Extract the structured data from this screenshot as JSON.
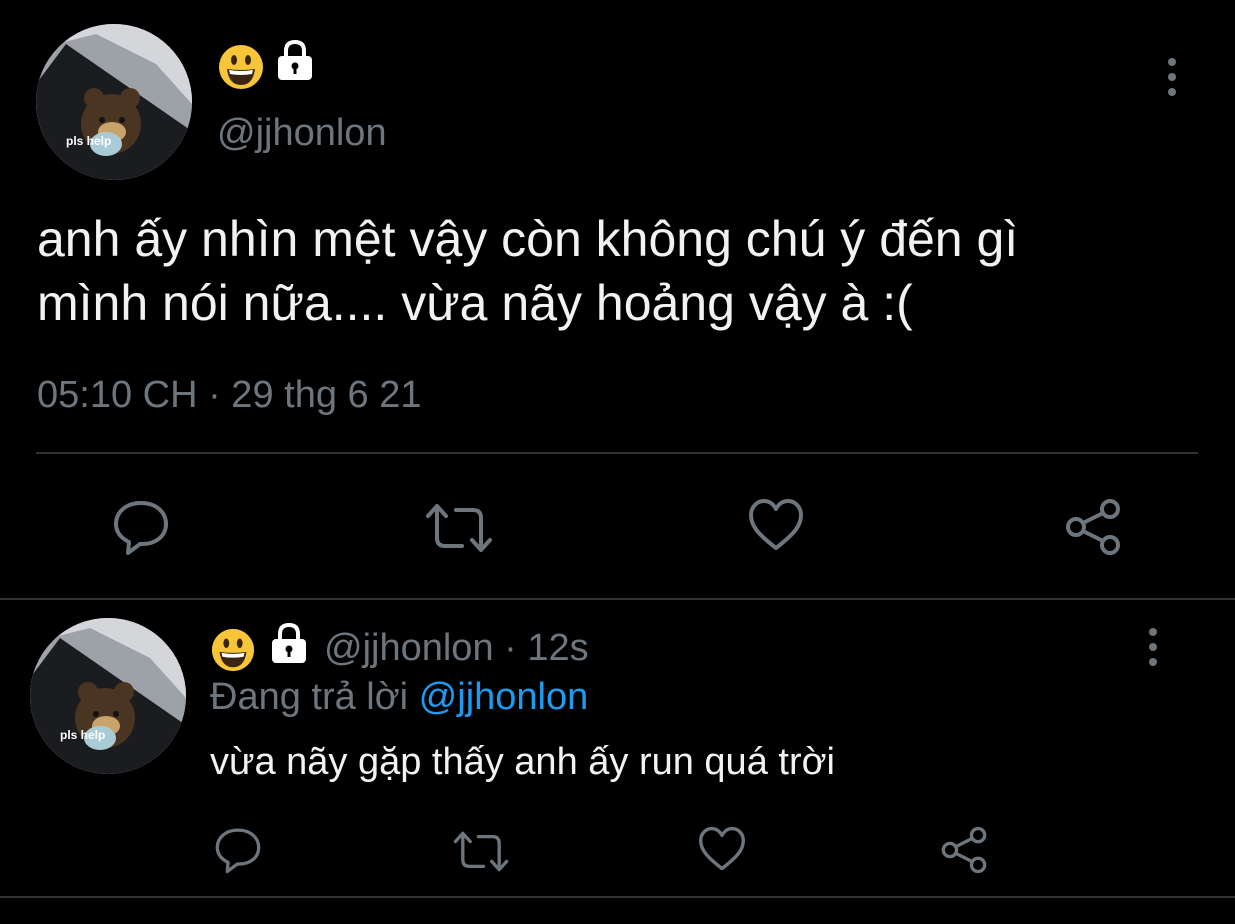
{
  "main_tweet": {
    "avatar_label": "pls help",
    "display_name_icons": [
      "grinning-face-emoji",
      "lock-icon"
    ],
    "handle": "@jjhonlon",
    "text_line1": "anh ấy nhìn mệt vậy còn không chú ý đến gì",
    "text_line2": "mình nói nữa.... vừa nãy hoảng vậy à :(",
    "timestamp": "05:10 CH · 29 thg 6 21",
    "actions": [
      "reply-icon",
      "retweet-icon",
      "like-icon",
      "share-icon"
    ]
  },
  "reply_tweet": {
    "avatar_label": "pls help",
    "handle": "@jjhonlon",
    "separator": "·",
    "time": "12s",
    "replying_prefix": "Đang trả lời",
    "replying_to": "@jjhonlon",
    "text": "vừa nãy gặp thấy anh ấy run quá trời",
    "actions": [
      "reply-icon",
      "retweet-icon",
      "like-icon",
      "share-icon"
    ]
  },
  "colors": {
    "background": "#000000",
    "text": "#e7e9ea",
    "muted": "#6e767d",
    "link": "#1d9bf0",
    "divider": "#2f3336"
  }
}
